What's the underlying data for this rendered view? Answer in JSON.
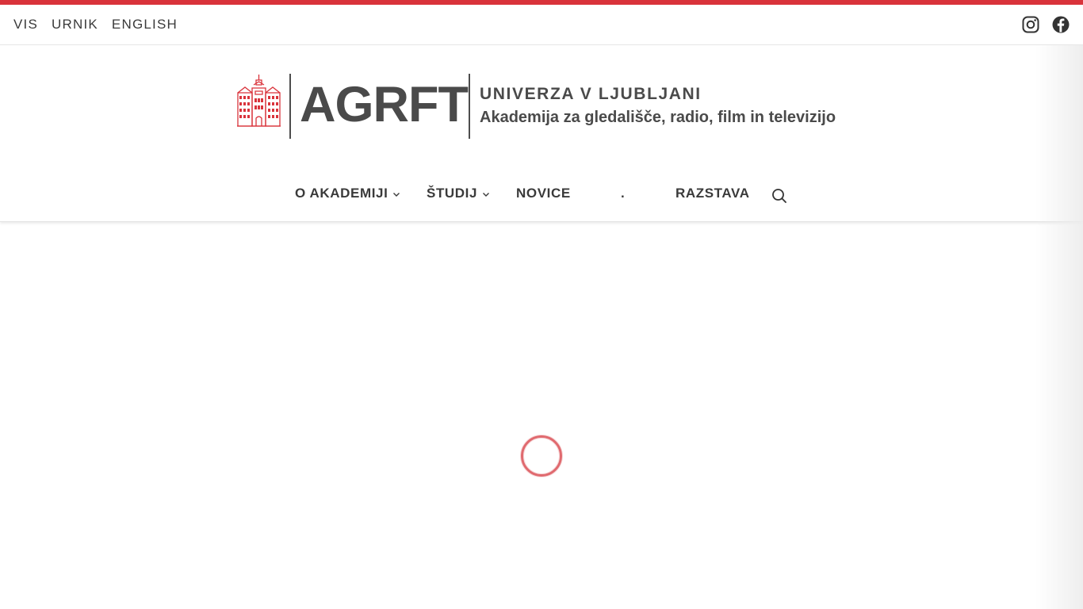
{
  "topbar": {
    "links": [
      {
        "label": "VIS"
      },
      {
        "label": "URNIK"
      },
      {
        "label": "ENGLISH"
      }
    ],
    "social": [
      {
        "icon": "instagram-icon"
      },
      {
        "icon": "facebook-icon"
      }
    ]
  },
  "logo": {
    "acronym": "AGRFT",
    "university": "UNIVERZA V LJUBLJANI",
    "academy": "Akademija za gledališče, radio, film in televizijo",
    "brand_color": "#d9333b",
    "text_color": "#4a4a4a"
  },
  "nav": {
    "items": [
      {
        "label": "O AKADEMIJI",
        "has_dropdown": true
      },
      {
        "label": "ŠTUDIJ",
        "has_dropdown": true
      },
      {
        "label": "NOVICE",
        "has_dropdown": false
      },
      {
        "label": ".",
        "has_dropdown": false
      },
      {
        "label": "RAZSTAVA",
        "has_dropdown": false
      }
    ],
    "search_icon": "search-icon"
  },
  "main": {
    "loading_indicator": "spinner"
  }
}
